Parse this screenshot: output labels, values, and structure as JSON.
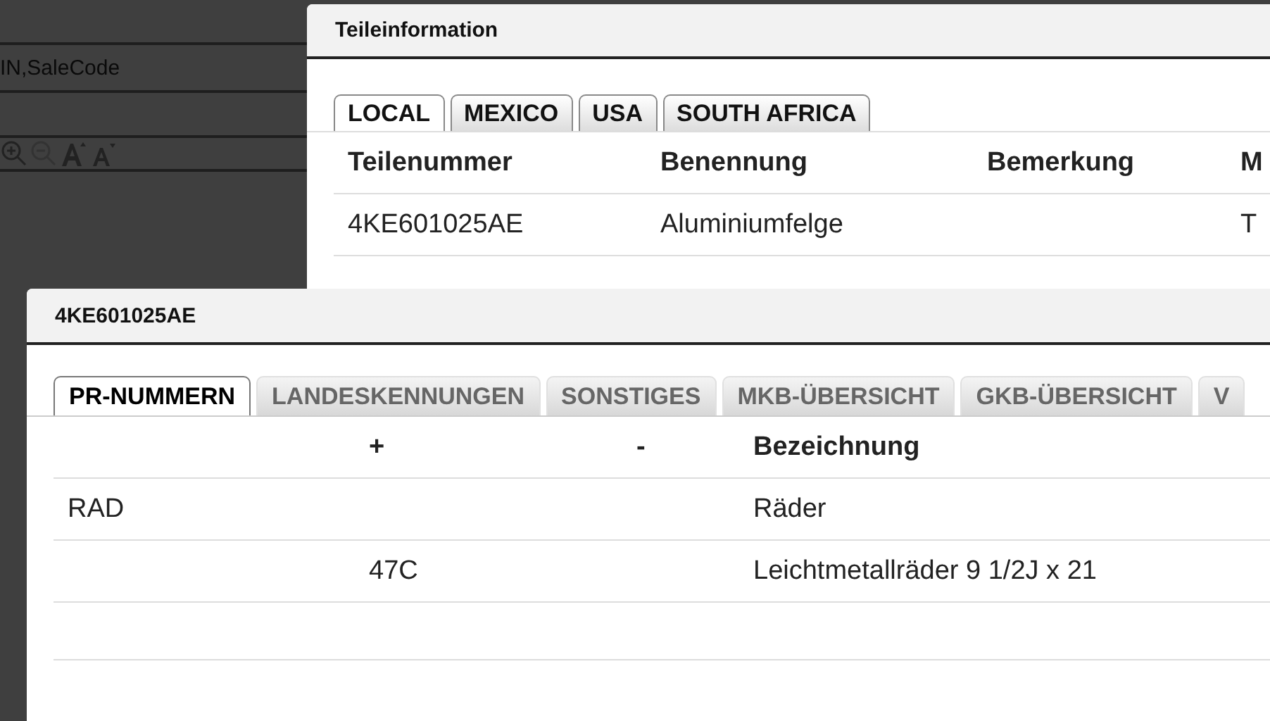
{
  "background": {
    "search_hint": "IN,SaleCode",
    "toolbar": [
      {
        "kind": "zoom-in"
      },
      {
        "kind": "zoom-out"
      },
      {
        "kind": "font-larger"
      },
      {
        "kind": "font-smaller"
      }
    ]
  },
  "dialogs": [
    {
      "title": "Teileinformation",
      "tabs": [
        {
          "label": "LOCAL",
          "selected": true
        },
        {
          "label": "MEXICO",
          "selected": false
        },
        {
          "label": "USA",
          "selected": false
        },
        {
          "label": "SOUTH AFRICA",
          "selected": false
        }
      ],
      "columns": [
        "Teilenummer",
        "Benennung",
        "Bemerkung",
        "M"
      ],
      "rows": [
        [
          "4KE601025AE",
          "Aluminiumfelge",
          "",
          "T"
        ]
      ]
    },
    {
      "title": "4KE601025AE",
      "tabs": [
        {
          "label": "PR-NUMMERN",
          "selected": true
        },
        {
          "label": "LANDESKENNUNGEN",
          "selected": false
        },
        {
          "label": "SONSTIGES",
          "selected": false
        },
        {
          "label": "MKB-ÜBERSICHT",
          "selected": false
        },
        {
          "label": "GKB-ÜBERSICHT",
          "selected": false
        },
        {
          "label": "V",
          "selected": false
        }
      ],
      "columns": [
        "",
        "+",
        "-",
        "Bezeichnung"
      ],
      "rows": [
        [
          "RAD",
          "",
          "",
          "Räder"
        ],
        [
          "",
          "47C",
          "",
          "Leichtmetallräder 9 1/2J x 21"
        ]
      ]
    }
  ]
}
